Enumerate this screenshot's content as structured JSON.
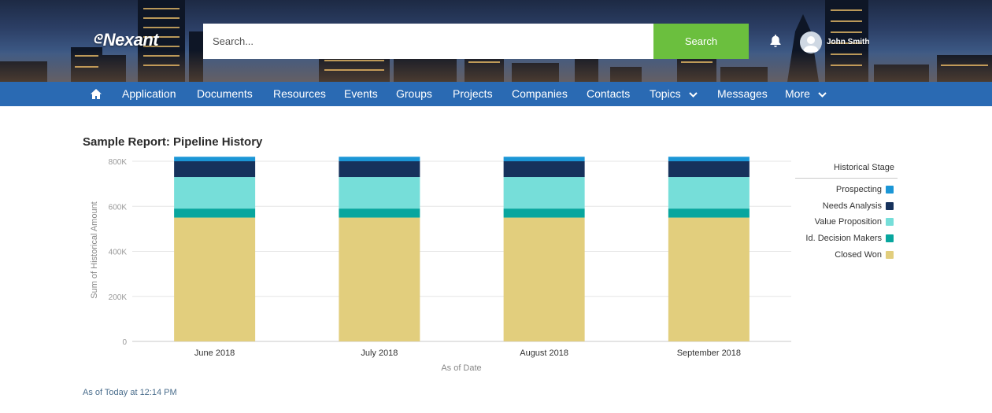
{
  "header": {
    "logo_text": "Nexant",
    "search_placeholder": "Search...",
    "search_button": "Search",
    "user_name": "John Smith"
  },
  "nav": {
    "items": [
      "Application",
      "Documents",
      "Resources",
      "Events",
      "Groups",
      "Projects",
      "Companies",
      "Contacts",
      "Topics",
      "Messages",
      "More"
    ]
  },
  "report": {
    "title": "Sample Report: Pipeline History",
    "footer": "As of Today at 12:14 PM"
  },
  "colors": {
    "prospecting": "#1b96d6",
    "needs_analysis": "#16325c",
    "value_proposition": "#76ded9",
    "id_decision_makers": "#08a69e",
    "closed_won": "#e2ce7d",
    "nav_blue": "#2a6ab3",
    "search_green": "#6bbf3e"
  },
  "chart_data": {
    "type": "bar",
    "stacked": true,
    "categories": [
      "June 2018",
      "July 2018",
      "August 2018",
      "September 2018"
    ],
    "series": [
      {
        "name": "Closed Won",
        "color": "#e2ce7d",
        "values": [
          550000,
          550000,
          550000,
          550000
        ]
      },
      {
        "name": "Id. Decision Makers",
        "color": "#08a69e",
        "values": [
          40000,
          40000,
          40000,
          40000
        ]
      },
      {
        "name": "Value Proposition",
        "color": "#76ded9",
        "values": [
          140000,
          140000,
          140000,
          140000
        ]
      },
      {
        "name": "Needs Analysis",
        "color": "#16325c",
        "values": [
          70000,
          70000,
          70000,
          70000
        ]
      },
      {
        "name": "Prospecting",
        "color": "#1b96d6",
        "values": [
          20000,
          20000,
          20000,
          20000
        ]
      }
    ],
    "legend_title": "Historical Stage",
    "legend": [
      "Prospecting",
      "Needs Analysis",
      "Value Proposition",
      "Id. Decision Makers",
      "Closed Won"
    ],
    "xlabel": "As of Date",
    "ylabel": "Sum of Historical Amount",
    "ylim": [
      0,
      800000
    ],
    "yticks": [
      0,
      200000,
      400000,
      600000,
      800000
    ],
    "ytick_labels": [
      "0",
      "200K",
      "400K",
      "600K",
      "800K"
    ],
    "grid": true,
    "legend_position": "right"
  }
}
